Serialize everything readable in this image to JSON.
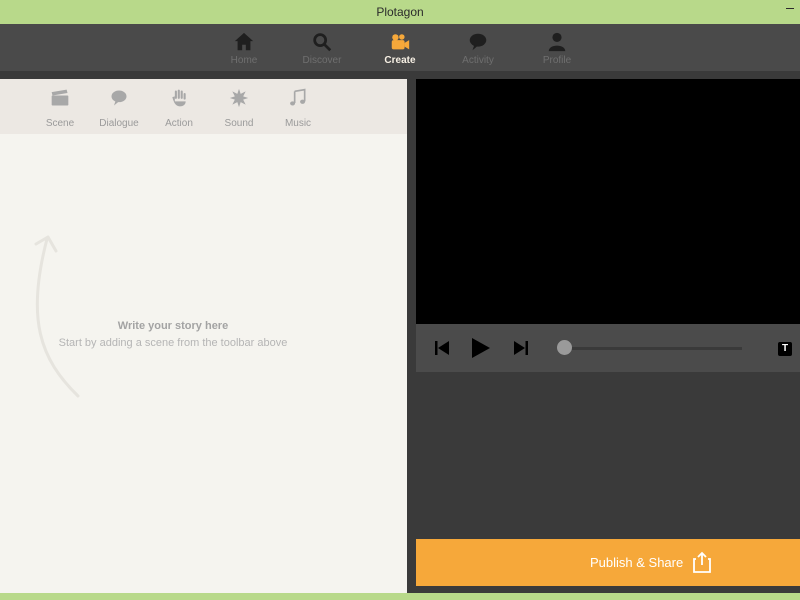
{
  "window": {
    "title": "Plotagon"
  },
  "topnav": {
    "items": [
      {
        "label": "Home",
        "icon": "home-icon"
      },
      {
        "label": "Discover",
        "icon": "search-icon"
      },
      {
        "label": "Create",
        "icon": "video-camera-icon",
        "active": true
      },
      {
        "label": "Activity",
        "icon": "speech-bubble-icon"
      },
      {
        "label": "Profile",
        "icon": "person-icon"
      }
    ]
  },
  "toolbar": {
    "items": [
      {
        "label": "Scene",
        "icon": "clapperboard-icon"
      },
      {
        "label": "Dialogue",
        "icon": "speech-bubble-icon"
      },
      {
        "label": "Action",
        "icon": "hand-icon"
      },
      {
        "label": "Sound",
        "icon": "sound-burst-icon"
      },
      {
        "label": "Music",
        "icon": "music-note-icon"
      }
    ]
  },
  "story": {
    "empty_title": "Write your story here",
    "empty_subtitle": "Start by adding a scene from the toolbar above"
  },
  "player": {
    "progress": 0
  },
  "publish": {
    "label": "Publish & Share"
  },
  "colors": {
    "accent": "#f6a83a",
    "window_chrome": "#b8d98a",
    "nav_background": "#4a4a4a",
    "active_nav_text": "#f7f0e4"
  }
}
